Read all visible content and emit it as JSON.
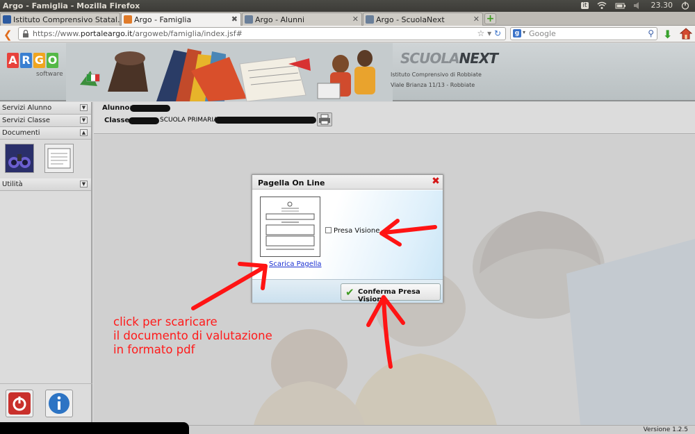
{
  "window": {
    "title": "Argo - Famiglia - Mozilla Firefox"
  },
  "system": {
    "keyboard": "it",
    "time": "23.30"
  },
  "tabs": [
    {
      "label": "Istituto Comprensivo Statal…",
      "active": false
    },
    {
      "label": "Argo - Famiglia",
      "active": true
    },
    {
      "label": "Argo - Alunni",
      "active": false
    },
    {
      "label": "Argo - ScuolaNext",
      "active": false
    }
  ],
  "nav": {
    "url_prefix": "https://www.",
    "url_host": "portaleargo.it",
    "url_path": "/argoweb/famiglia/index.jsf#",
    "search_placeholder": "Google"
  },
  "banner": {
    "logo_letters": [
      "A",
      "R",
      "G",
      "O"
    ],
    "logo_colors": [
      "#e8423c",
      "#3a7fd1",
      "#f0a51f",
      "#54b847"
    ],
    "logo_sub": "software",
    "brand_a": "SCUOLA",
    "brand_b": "NEXT",
    "school_name": "Istituto Comprensivo di Robbiate",
    "school_address": "Viale Brianza 11/13 - Robbiate"
  },
  "sidebar": {
    "sections": [
      {
        "label": "Servizi Alunno"
      },
      {
        "label": "Servizi Classe"
      },
      {
        "label": "Documenti"
      },
      {
        "label": "Utilità"
      }
    ]
  },
  "student": {
    "alunno_label": "Alunno:",
    "classe_label": "Classe:",
    "school_type": "SCUOLA PRIMARIA"
  },
  "dialog": {
    "title": "Pagella On Line",
    "checkbox_label": "Presa Visione",
    "download_link": "Scarica Pagella",
    "confirm_button": "Conferma Presa Visione"
  },
  "annotation": {
    "line1": "click per scaricare",
    "line2": "il documento di valutazione",
    "line3": "in formato pdf",
    "color": "#ff1a1a"
  },
  "status": {
    "version": "Versione 1.2.5"
  }
}
